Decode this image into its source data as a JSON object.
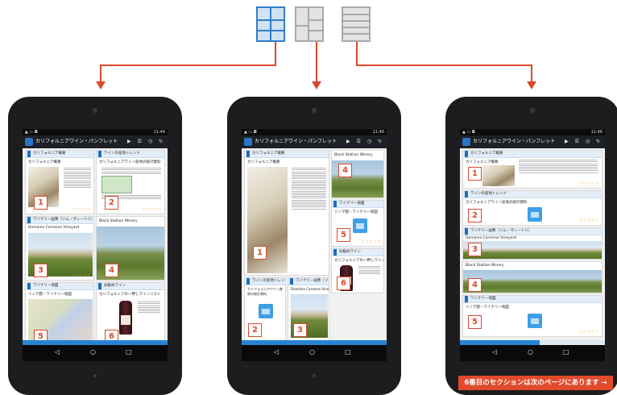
{
  "app": {
    "title": "カリフォルニアワイン・パンフレット",
    "status_time": "11:44",
    "status_time_2": "11:46",
    "status_time_3": "11:46",
    "actions": "▶ ☰ ◷ ↻"
  },
  "sections": {
    "s1": {
      "label": "カリフォルニア概要",
      "sub": "カリフォルニア概要"
    },
    "s2": {
      "label": "ワインの産地トレンド",
      "sub": "カリフォルニアワイン産地の統計資料"
    },
    "s3": {
      "label": "ワイナリー画像（ソム・ヴィートリ）",
      "sub": "Domaine Carneros Vineyard"
    },
    "s4": {
      "label": "Black Stallion Winery"
    },
    "s5": {
      "label": "ワイナリー地図",
      "sub": "ソノマ郡・ワイナリー地図"
    },
    "s6": {
      "label": "お勧めワイン",
      "sub": "カリフォルニアの一押しワインリスト"
    }
  },
  "badges": [
    "1",
    "2",
    "3",
    "4",
    "5",
    "6"
  ],
  "stars": "☆☆☆☆☆",
  "nav": {
    "back": "◁",
    "home": "○",
    "recent": "□"
  },
  "progress": {
    "left": 1.0,
    "right": 0.55
  },
  "footer_note": "6番目のセクションは次のページにあります →",
  "colors": {
    "accent": "#2f7fc9",
    "arrow": "#d94a2e",
    "banner": "#e24a2c"
  },
  "icons": [
    "grid-layout-icon",
    "masonry-layout-icon",
    "list-layout-icon",
    "pdf-icon",
    "wine-bottle-icon"
  ]
}
